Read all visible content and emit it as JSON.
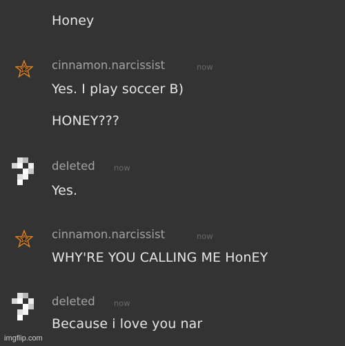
{
  "messages": [
    {
      "text": "Honey"
    },
    {
      "username": "cinnamon.narcissist",
      "timestamp": "now",
      "lines": [
        "Yes. I play soccer B)",
        "HONEY???"
      ],
      "avatar": "star-icon"
    },
    {
      "username": "deIeted",
      "timestamp": "now",
      "lines": [
        "Yes."
      ],
      "avatar": "pixel-block-icon"
    },
    {
      "username": "cinnamon.narcissist",
      "timestamp": "now",
      "lines": [
        "WHY'RE YOU CALLING ME HonEY"
      ],
      "avatar": "star-icon"
    },
    {
      "username": "deIeted",
      "timestamp": "now",
      "lines": [
        "Because i love you nar"
      ],
      "avatar": "pixel-block-icon"
    }
  ],
  "watermark": "imgflip.com",
  "colors": {
    "background": "#333333",
    "message_text": "#e6e6e6",
    "username": "#a3a3a3",
    "timestamp": "#6a6a6a",
    "star": "#d9821f"
  }
}
